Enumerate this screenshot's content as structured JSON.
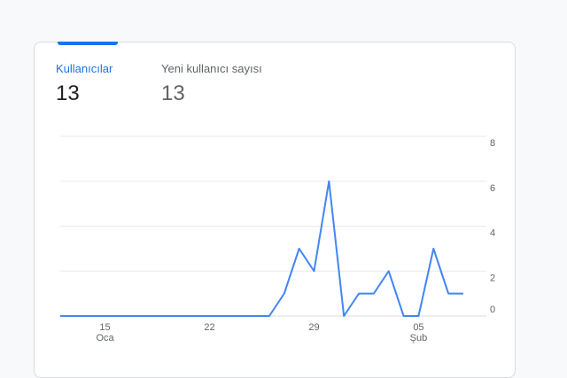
{
  "tabs": [
    {
      "label": "Kullanıcılar",
      "value": "13",
      "active": true
    },
    {
      "label": "Yeni kullanıcı sayısı",
      "value": "13",
      "active": false
    }
  ],
  "colors": {
    "accent": "#1a73e8",
    "line": "#4285f4",
    "grid": "#e8eaed"
  },
  "chart_data": {
    "type": "line",
    "y_ticks": [
      "8",
      "6",
      "4",
      "2",
      "0"
    ],
    "x_ticks": [
      {
        "label": "15",
        "sub": "Oca",
        "index": 3
      },
      {
        "label": "22",
        "sub": "",
        "index": 10
      },
      {
        "label": "29",
        "sub": "",
        "index": 17
      },
      {
        "label": "05",
        "sub": "Şub",
        "index": 24
      }
    ],
    "ylim": [
      0,
      8
    ],
    "series": [
      {
        "values": [
          0,
          0,
          0,
          0,
          0,
          0,
          0,
          0,
          0,
          0,
          0,
          0,
          0,
          0,
          0,
          1,
          3,
          2,
          6,
          0,
          1,
          1,
          2,
          0,
          0,
          3,
          1,
          1
        ]
      }
    ],
    "grid": true
  }
}
